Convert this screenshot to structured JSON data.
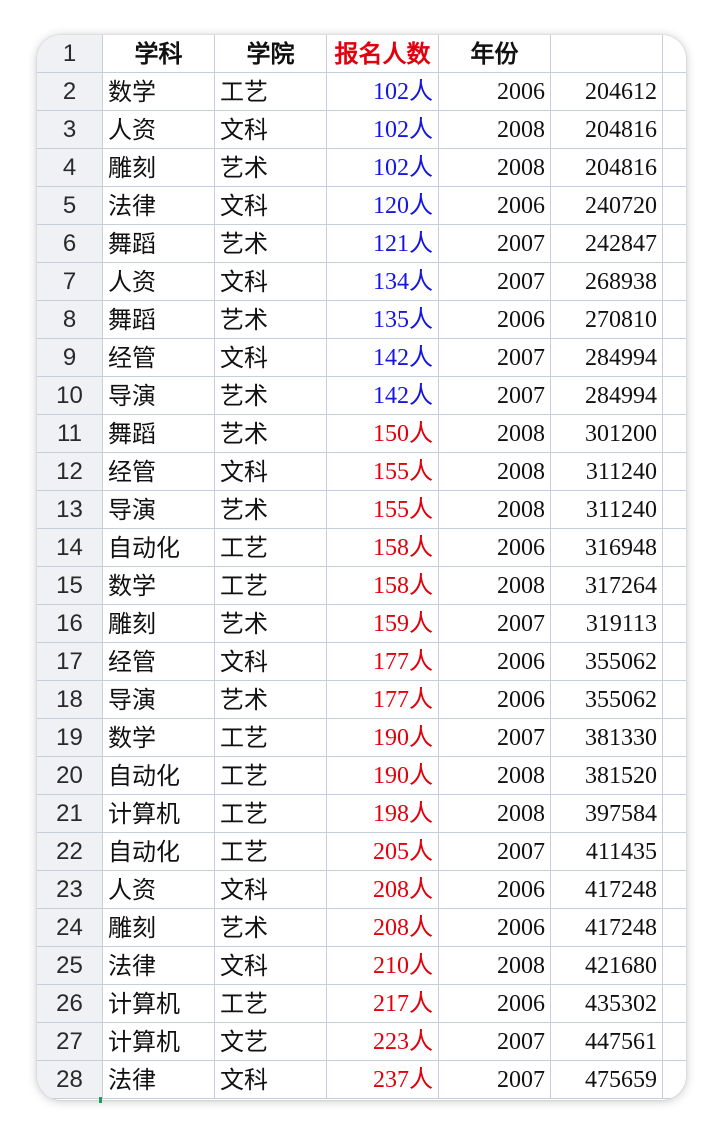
{
  "colors": {
    "blue": "#1616e2",
    "red": "#e2000c"
  },
  "sheet": {
    "header": {
      "row_number": "1",
      "subject": "学科",
      "college": "学院",
      "enrollment": "报名人数",
      "enrollment_color": "red",
      "year": "年份"
    },
    "rows": [
      {
        "num": "2",
        "subject": "数学",
        "college": "工艺",
        "enrollment": "102人",
        "year": "2006",
        "value": "204612",
        "enrollment_color": "blue"
      },
      {
        "num": "3",
        "subject": "人资",
        "college": "文科",
        "enrollment": "102人",
        "year": "2008",
        "value": "204816",
        "enrollment_color": "blue"
      },
      {
        "num": "4",
        "subject": "雕刻",
        "college": "艺术",
        "enrollment": "102人",
        "year": "2008",
        "value": "204816",
        "enrollment_color": "blue"
      },
      {
        "num": "5",
        "subject": "法律",
        "college": "文科",
        "enrollment": "120人",
        "year": "2006",
        "value": "240720",
        "enrollment_color": "blue"
      },
      {
        "num": "6",
        "subject": "舞蹈",
        "college": "艺术",
        "enrollment": "121人",
        "year": "2007",
        "value": "242847",
        "enrollment_color": "blue"
      },
      {
        "num": "7",
        "subject": "人资",
        "college": "文科",
        "enrollment": "134人",
        "year": "2007",
        "value": "268938",
        "enrollment_color": "blue"
      },
      {
        "num": "8",
        "subject": "舞蹈",
        "college": "艺术",
        "enrollment": "135人",
        "year": "2006",
        "value": "270810",
        "enrollment_color": "blue"
      },
      {
        "num": "9",
        "subject": "经管",
        "college": "文科",
        "enrollment": "142人",
        "year": "2007",
        "value": "284994",
        "enrollment_color": "blue"
      },
      {
        "num": "10",
        "subject": "导演",
        "college": "艺术",
        "enrollment": "142人",
        "year": "2007",
        "value": "284994",
        "enrollment_color": "blue"
      },
      {
        "num": "11",
        "subject": "舞蹈",
        "college": "艺术",
        "enrollment": "150人",
        "year": "2008",
        "value": "301200",
        "enrollment_color": "red"
      },
      {
        "num": "12",
        "subject": "经管",
        "college": "文科",
        "enrollment": "155人",
        "year": "2008",
        "value": "311240",
        "enrollment_color": "red"
      },
      {
        "num": "13",
        "subject": "导演",
        "college": "艺术",
        "enrollment": "155人",
        "year": "2008",
        "value": "311240",
        "enrollment_color": "red"
      },
      {
        "num": "14",
        "subject": "自动化",
        "college": "工艺",
        "enrollment": "158人",
        "year": "2006",
        "value": "316948",
        "enrollment_color": "red"
      },
      {
        "num": "15",
        "subject": "数学",
        "college": "工艺",
        "enrollment": "158人",
        "year": "2008",
        "value": "317264",
        "enrollment_color": "red"
      },
      {
        "num": "16",
        "subject": "雕刻",
        "college": "艺术",
        "enrollment": "159人",
        "year": "2007",
        "value": "319113",
        "enrollment_color": "red"
      },
      {
        "num": "17",
        "subject": "经管",
        "college": "文科",
        "enrollment": "177人",
        "year": "2006",
        "value": "355062",
        "enrollment_color": "red"
      },
      {
        "num": "18",
        "subject": "导演",
        "college": "艺术",
        "enrollment": "177人",
        "year": "2006",
        "value": "355062",
        "enrollment_color": "red"
      },
      {
        "num": "19",
        "subject": "数学",
        "college": "工艺",
        "enrollment": "190人",
        "year": "2007",
        "value": "381330",
        "enrollment_color": "red"
      },
      {
        "num": "20",
        "subject": "自动化",
        "college": "工艺",
        "enrollment": "190人",
        "year": "2008",
        "value": "381520",
        "enrollment_color": "red"
      },
      {
        "num": "21",
        "subject": "计算机",
        "college": "工艺",
        "enrollment": "198人",
        "year": "2008",
        "value": "397584",
        "enrollment_color": "red"
      },
      {
        "num": "22",
        "subject": "自动化",
        "college": "工艺",
        "enrollment": "205人",
        "year": "2007",
        "value": "411435",
        "enrollment_color": "red"
      },
      {
        "num": "23",
        "subject": "人资",
        "college": "文科",
        "enrollment": "208人",
        "year": "2006",
        "value": "417248",
        "enrollment_color": "red"
      },
      {
        "num": "24",
        "subject": "雕刻",
        "college": "艺术",
        "enrollment": "208人",
        "year": "2006",
        "value": "417248",
        "enrollment_color": "red"
      },
      {
        "num": "25",
        "subject": "法律",
        "college": "文科",
        "enrollment": "210人",
        "year": "2008",
        "value": "421680",
        "enrollment_color": "red"
      },
      {
        "num": "26",
        "subject": "计算机",
        "college": "工艺",
        "enrollment": "217人",
        "year": "2006",
        "value": "435302",
        "enrollment_color": "red"
      },
      {
        "num": "27",
        "subject": "计算机",
        "college": "文艺",
        "enrollment": "223人",
        "year": "2007",
        "value": "447561",
        "enrollment_color": "red"
      },
      {
        "num": "28",
        "subject": "法律",
        "college": "文科",
        "enrollment": "237人",
        "year": "2007",
        "value": "475659",
        "enrollment_color": "red"
      }
    ]
  }
}
